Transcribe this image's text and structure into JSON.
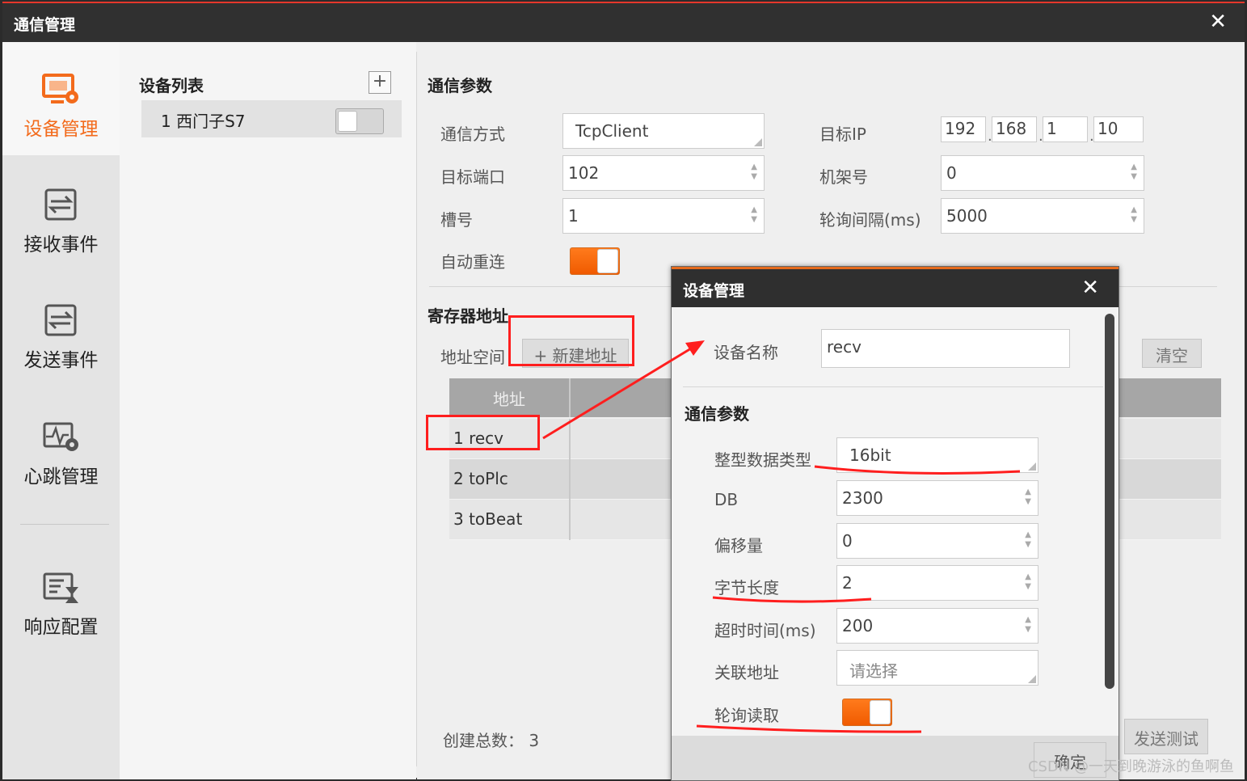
{
  "window": {
    "title": "通信管理",
    "close": "✕"
  },
  "nav": [
    {
      "label": "设备管理",
      "icon": "device-settings-icon",
      "active": true
    },
    {
      "label": "接收事件",
      "icon": "receive-icon"
    },
    {
      "label": "发送事件",
      "icon": "send-icon"
    },
    {
      "label": "心跳管理",
      "icon": "heartbeat-icon"
    },
    {
      "label": "响应配置",
      "icon": "response-config-icon"
    }
  ],
  "devlist": {
    "title": "设备列表",
    "add": "+",
    "items": [
      {
        "label": "1 西门子S7"
      }
    ]
  },
  "comm": {
    "title": "通信参数",
    "method_label": "通信方式",
    "method_value": "TcpClient",
    "ip_label": "目标IP",
    "ip": [
      "192",
      "168",
      "1",
      "10"
    ],
    "port_label": "目标端口",
    "port_value": "102",
    "rack_label": "机架号",
    "rack_value": "0",
    "slot_label": "槽号",
    "slot_value": "1",
    "poll_label": "轮询间隔(ms)",
    "poll_value": "5000",
    "reconnect_label": "自动重连"
  },
  "registers": {
    "title": "寄存器地址",
    "space_label": "地址空间",
    "new_btn": "+ 新建地址",
    "clear_btn": "清空",
    "send_test_btn": "发送测试",
    "col_address": "地址",
    "rows": [
      "1 recv",
      "2 toPlc",
      "3 toBeat"
    ],
    "total": "创建总数： 3"
  },
  "dialog": {
    "title": "设备管理",
    "close": "✕",
    "name_label": "设备名称",
    "name_value": "recv",
    "section": "通信参数",
    "type_label": "整型数据类型",
    "type_value": "16bit",
    "db_label": "DB",
    "db_value": "2300",
    "offset_label": "偏移量",
    "offset_value": "0",
    "len_label": "字节长度",
    "len_value": "2",
    "timeout_label": "超时时间(ms)",
    "timeout_value": "200",
    "link_label": "关联地址",
    "link_placeholder": "请选择",
    "poll_read_label": "轮询读取",
    "ok": "确定"
  },
  "watermark": "CSDN @一天到晚游泳的鱼啊鱼",
  "colors": {
    "accent": "#f36b1c",
    "annotation": "#ff1e1e",
    "titlebar": "#303030"
  }
}
